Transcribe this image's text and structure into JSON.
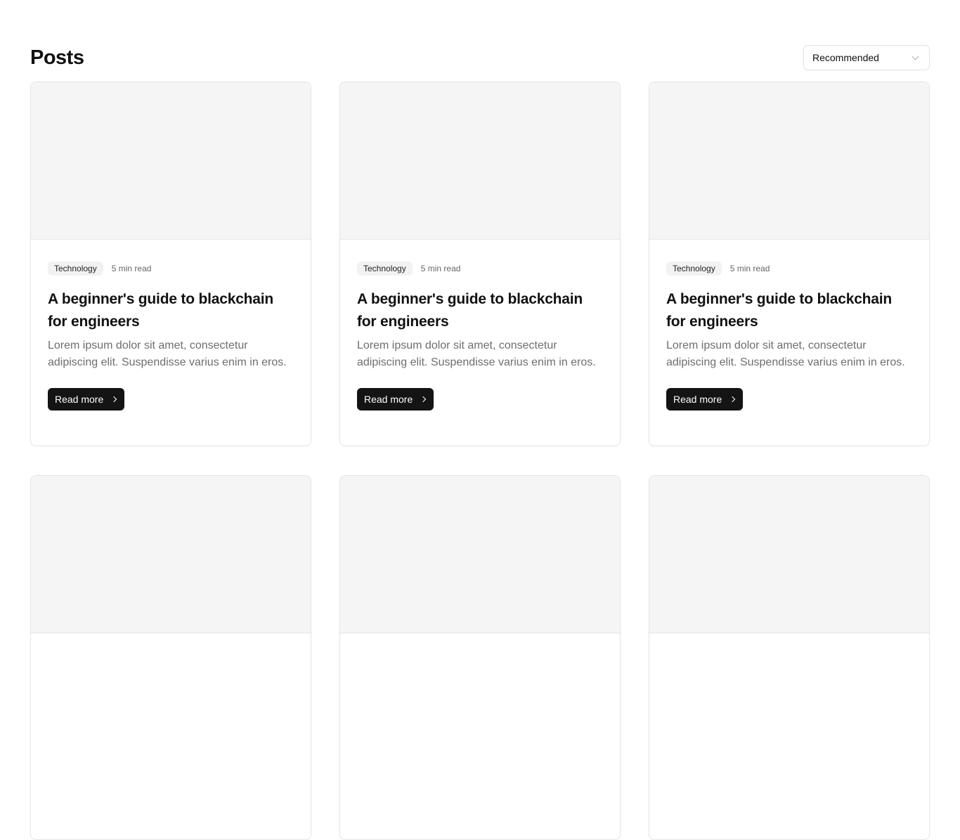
{
  "header": {
    "title": "Posts",
    "sort": {
      "selected": "Recommended"
    }
  },
  "posts": [
    {
      "tag": "Technology",
      "read_time": "5 min read",
      "title": "A beginner's guide to blackchain for engineers",
      "description": "Lorem ipsum dolor sit amet, consectetur adipiscing elit. Suspendisse varius enim in eros.",
      "cta": "Read more"
    },
    {
      "tag": "Technology",
      "read_time": "5 min read",
      "title": "A beginner's guide to blackchain for engineers",
      "description": "Lorem ipsum dolor sit amet, consectetur adipiscing elit. Suspendisse varius enim in eros.",
      "cta": "Read more"
    },
    {
      "tag": "Technology",
      "read_time": "5 min read",
      "title": "A beginner's guide to blackchain for engineers",
      "description": "Lorem ipsum dolor sit amet, consectetur adipiscing elit. Suspendisse varius enim in eros.",
      "cta": "Read more"
    },
    {},
    {},
    {}
  ]
}
